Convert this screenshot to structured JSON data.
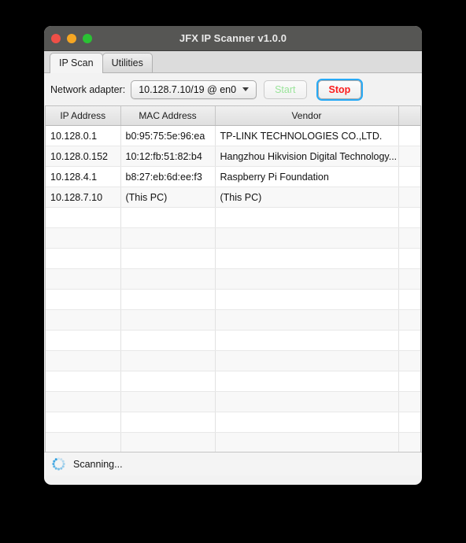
{
  "window": {
    "title": "JFX IP Scanner v1.0.0",
    "traffic_lights": [
      {
        "name": "close-button",
        "color": "#ef4f47"
      },
      {
        "name": "minimize-button",
        "color": "#f5a623"
      },
      {
        "name": "maximize-button",
        "color": "#2ac234"
      }
    ]
  },
  "tabs": [
    {
      "label": "IP Scan",
      "active": true
    },
    {
      "label": "Utilities",
      "active": false
    }
  ],
  "toolbar": {
    "adapter_label": "Network adapter:",
    "adapter_value": "10.128.7.10/19 @ en0",
    "caret_icon": "chevron-down-icon",
    "start_label": "Start",
    "start_enabled": false,
    "stop_label": "Stop",
    "stop_focused": true,
    "start_color": "#9ae49a",
    "stop_color": "#fb1d1d",
    "focus_ring_color": "#28aaf5"
  },
  "table": {
    "columns": [
      "IP Address",
      "MAC Address",
      "Vendor",
      ""
    ],
    "rows": [
      [
        "10.128.0.1",
        "b0:95:75:5e:96:ea",
        "TP-LINK TECHNOLOGIES CO.,LTD.",
        ""
      ],
      [
        "10.128.0.152",
        "10:12:fb:51:82:b4",
        "Hangzhou Hikvision Digital Technology...",
        ""
      ],
      [
        "10.128.4.1",
        "b8:27:eb:6d:ee:f3",
        "Raspberry Pi Foundation",
        ""
      ],
      [
        "10.128.7.10",
        "(This PC)",
        "(This PC)",
        ""
      ],
      [
        "",
        "",
        "",
        ""
      ],
      [
        "",
        "",
        "",
        ""
      ],
      [
        "",
        "",
        "",
        ""
      ],
      [
        "",
        "",
        "",
        ""
      ],
      [
        "",
        "",
        "",
        ""
      ],
      [
        "",
        "",
        "",
        ""
      ],
      [
        "",
        "",
        "",
        ""
      ],
      [
        "",
        "",
        "",
        ""
      ],
      [
        "",
        "",
        "",
        ""
      ],
      [
        "",
        "",
        "",
        ""
      ],
      [
        "",
        "",
        "",
        ""
      ],
      [
        "",
        "",
        "",
        ""
      ],
      [
        "",
        "",
        "",
        ""
      ]
    ]
  },
  "statusbar": {
    "spinner_icon": "loading-spinner-icon",
    "spinner_color": "#2f9fe0",
    "text": "Scanning..."
  }
}
